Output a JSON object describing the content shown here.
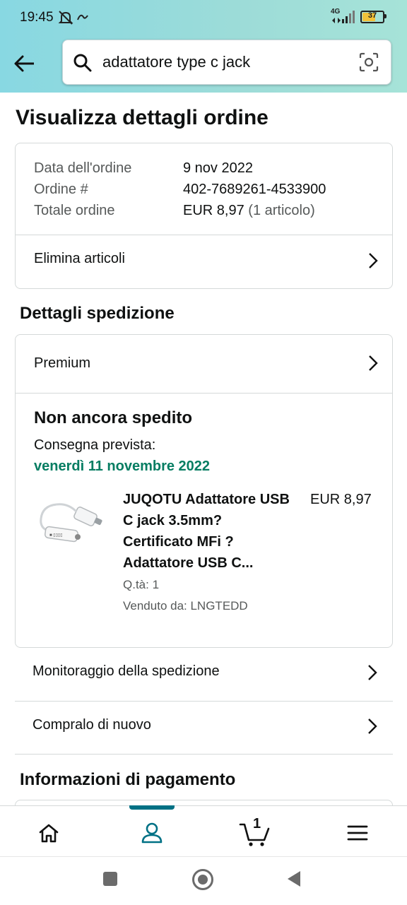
{
  "status_bar": {
    "time": "19:45",
    "network": "4G",
    "battery": "37"
  },
  "search": {
    "query": "adattatore type c jack"
  },
  "page": {
    "title": "Visualizza dettagli ordine"
  },
  "order_summary": {
    "rows": [
      {
        "label": "Data dell'ordine",
        "value": "9 nov 2022"
      },
      {
        "label": "Ordine #",
        "value": "402-7689261-4533900"
      },
      {
        "label": "Totale ordine",
        "value": "EUR 8,97",
        "extra": "(1 articolo)"
      }
    ],
    "delete_items": "Elimina articoli"
  },
  "shipping": {
    "section_title": "Dettagli spedizione",
    "shipping_type": "Premium",
    "status": "Non ancora spedito",
    "delivery_label": "Consegna prevista:",
    "delivery_date": "venerdì 11 novembre 2022",
    "product": {
      "title": "JUQOTU Adattatore USB C jack 3.5mm? Certificato MFi ? Adattatore USB C...",
      "price": "EUR 8,97",
      "quantity": "Q.tà: 1",
      "seller": "Venduto da: LNGTEDD"
    }
  },
  "actions": {
    "track": "Monitoraggio della spedizione",
    "buy_again": "Compralo di nuovo"
  },
  "payment": {
    "section_title": "Informazioni di pagamento"
  },
  "bottom_nav": {
    "cart_count": "1",
    "accent": "#007185"
  }
}
